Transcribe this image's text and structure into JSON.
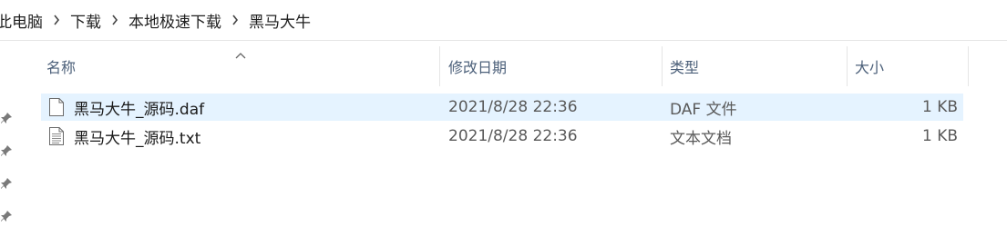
{
  "breadcrumb": [
    "此电脑",
    "下载",
    "本地极速下载",
    "黑马大牛"
  ],
  "columns": {
    "name": "名称",
    "modified": "修改日期",
    "type": "类型",
    "size": "大小"
  },
  "files": [
    {
      "name": "黑马大牛_源码.daf",
      "modified": "2021/8/28 22:36",
      "type": "DAF 文件",
      "size": "1 KB",
      "icon": "blank-file-icon",
      "selected": true
    },
    {
      "name": "黑马大牛_源码.txt",
      "modified": "2021/8/28 22:36",
      "type": "文本文档",
      "size": "1 KB",
      "icon": "text-file-icon",
      "selected": false
    }
  ],
  "colors": {
    "selection": "#e5f3ff",
    "header_text": "#4c607a"
  }
}
